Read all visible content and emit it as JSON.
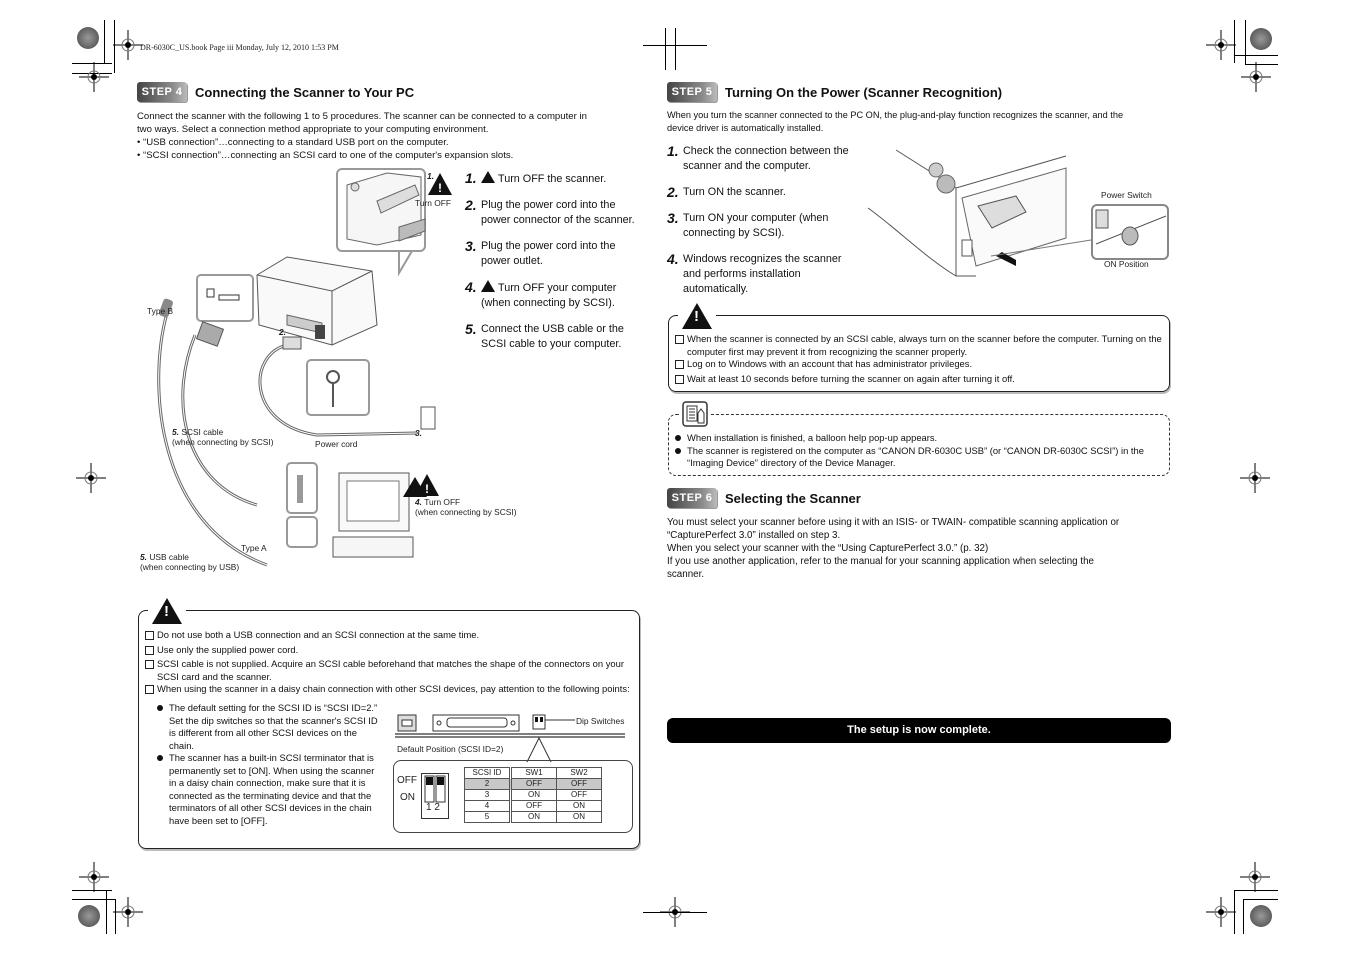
{
  "slug": "DR-6030C_US.book  Page iii  Monday, July 12, 2010  1:53 PM",
  "step4": {
    "badge": "STEP 4",
    "title": "Connecting the Scanner to Your PC",
    "intro": [
      "Connect the scanner with the following 1 to 5 procedures. The scanner can be connected to a computer in",
      "two ways. Select a connection method appropriate to your computing environment.",
      "• “USB connection”…connecting to a standard USB port on the computer.",
      "• “SCSI connection”…connecting an SCSI card to one of the computer's expansion slots."
    ],
    "steps": [
      {
        "num": "1.",
        "warn": true,
        "text": "Turn OFF the scanner."
      },
      {
        "num": "2.",
        "warn": false,
        "text": "Plug the power cord into the power connector of the scanner."
      },
      {
        "num": "3.",
        "warn": false,
        "text": "Plug the power cord into the power outlet."
      },
      {
        "num": "4.",
        "warn": true,
        "text": "Turn OFF your computer (when connecting by SCSI)."
      },
      {
        "num": "5.",
        "warn": false,
        "text": "Connect the USB cable or the SCSI cable to your computer."
      }
    ],
    "figure": {
      "callout_1_num": "1.",
      "callout_1_label": "Turn OFF",
      "type_b": "Type B",
      "callout_2": "2.",
      "callout_3": "3.",
      "scsi_cable_num": "5.",
      "scsi_cable_label": "SCSI cable",
      "scsi_cable_note": "(when connecting by SCSI)",
      "power_cord": "Power cord",
      "turn_off_num": "4.",
      "turn_off_label": "Turn OFF",
      "turn_off_note": "(when connecting by SCSI)",
      "type_a": "Type A",
      "usb_cable_num": "5.",
      "usb_cable_label": "USB cable",
      "usb_cable_note": "(when connecting by USB)"
    },
    "caution": {
      "items": [
        "Do not use both a USB connection and an SCSI connection at the same time.",
        "Use only the supplied power cord.",
        "SCSI cable is not supplied. Acquire an SCSI cable beforehand that matches the shape of the connectors on your SCSI card and the scanner.",
        "When using the scanner in a daisy chain connection with other SCSI devices, pay attention to the following points:"
      ],
      "subitems": [
        "The default setting for the SCSI ID is “SCSI ID=2.” Set the dip switches so that the scanner's SCSI ID is different from all other SCSI devices on the chain.",
        "The scanner has a built-in SCSI terminator that is permanently set to [ON]. When using the scanner in a daisy chain connection, make sure that it is connected as the terminating device and that the terminators of all other SCSI devices in the chain have been set to [OFF]."
      ],
      "dip_label": "Dip Switches",
      "default_position": "Default Position (SCSI ID=2)",
      "off_label": "OFF",
      "on_label": "ON",
      "switch_numbers": "1 2",
      "table": {
        "headers": [
          "SCSI ID",
          "SW1",
          "SW2"
        ],
        "rows": [
          [
            "2",
            "OFF",
            "OFF"
          ],
          [
            "3",
            "ON",
            "OFF"
          ],
          [
            "4",
            "OFF",
            "ON"
          ],
          [
            "5",
            "ON",
            "ON"
          ]
        ],
        "highlighted_row": 0
      }
    }
  },
  "step5": {
    "badge": "STEP 5",
    "title": "Turning On the Power (Scanner Recognition)",
    "intro": [
      "When you turn the scanner connected to the PC ON, the plug-and-play function recognizes the scanner, and the",
      "device driver is automatically installed."
    ],
    "steps": [
      {
        "num": "1.",
        "text": "Check the connection between the scanner and the computer."
      },
      {
        "num": "2.",
        "text": "Turn ON the scanner."
      },
      {
        "num": "3.",
        "text": "Turn ON your computer (when connecting by SCSI)."
      },
      {
        "num": "4.",
        "text": "Windows recognizes the scanner and performs installation automatically."
      }
    ],
    "figure": {
      "power_switch": "Power Switch",
      "on_position": "ON Position"
    },
    "caution": [
      "When the scanner is connected by an SCSI cable, always turn on the scanner before the computer. Turning on the computer first may prevent it from recognizing the scanner properly.",
      "Log on to Windows with an account that has administrator privileges.",
      "Wait at least 10 seconds before turning the scanner on again after turning it off."
    ],
    "note": [
      "When installation is finished, a balloon help pop-up appears.",
      "The scanner is registered on the computer as “CANON DR-6030C USB” (or “CANON DR-6030C SCSI”) in the “Imaging Device” directory of the Device Manager."
    ]
  },
  "step6": {
    "badge": "STEP 6",
    "title": "Selecting the Scanner",
    "body": [
      "You must select your scanner before using it with an ISIS- or TWAIN- compatible scanning application or",
      "“CapturePerfect 3.0” installed on step 3.",
      "When you select your scanner with the “Using CapturePerfect 3.0.” (p. 32)",
      "If you use another application, refer to the manual for your scanning application when selecting the",
      "scanner."
    ]
  },
  "banner": "The setup is now complete."
}
